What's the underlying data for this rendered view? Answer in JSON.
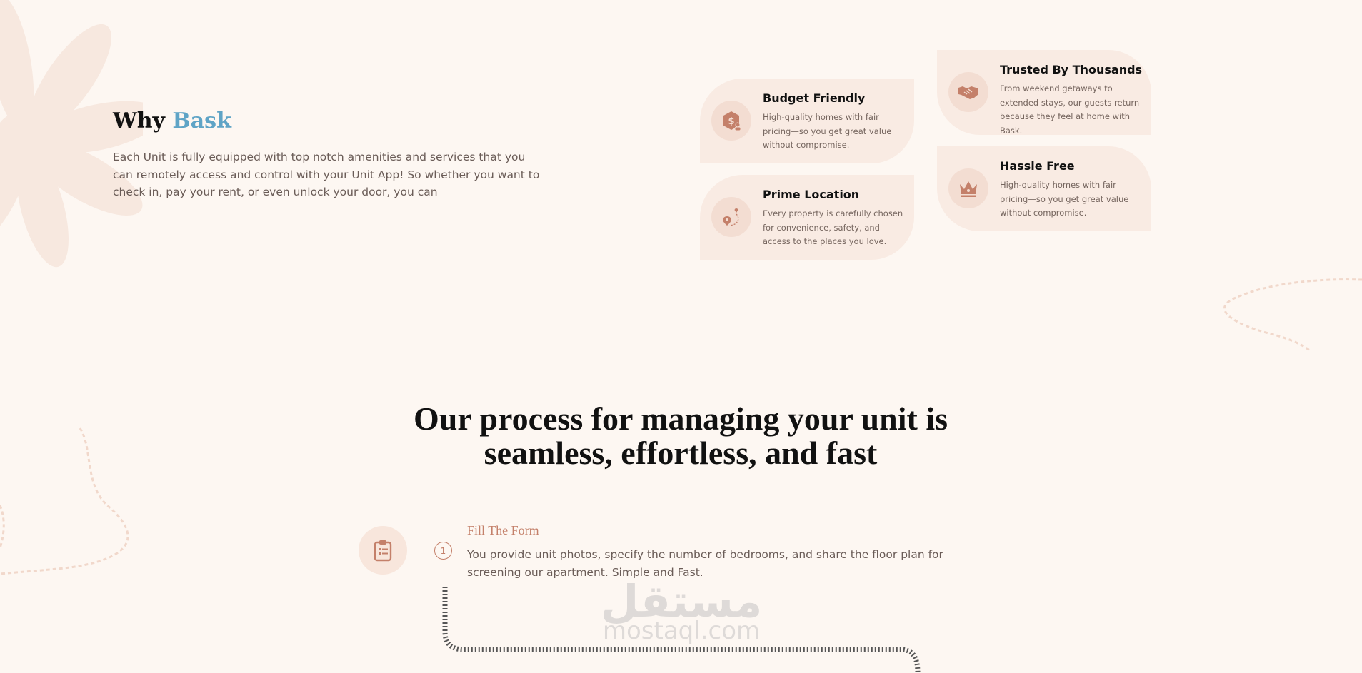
{
  "why": {
    "title_prefix": "Why",
    "title_accent": "Bask",
    "description": "Each Unit is fully equipped with top notch amenities and services that you can remotely access and control with your Unit App! So whether you want to check in, pay your rent, or even unlock your door, you can"
  },
  "features": [
    {
      "title": "Budget Friendly",
      "description": "High-quality homes with fair pricing—so you get great value without compromise.",
      "icon": "price-tag-icon"
    },
    {
      "title": "Prime Location",
      "description": "Every property is carefully chosen for convenience, safety, and access to the places you love.",
      "icon": "location-pin-icon"
    },
    {
      "title": "Trusted By Thousands",
      "description": "From weekend getaways to extended stays, our guests return because they feel at home with Bask.",
      "icon": "handshake-icon"
    },
    {
      "title": "Hassle Free",
      "description": "High-quality homes with fair pricing—so you get great value without compromise.",
      "icon": "crown-icon"
    }
  ],
  "process": {
    "title_line1": "Our process for managing your unit is",
    "title_line2": "seamless, effortless, and fast",
    "steps": [
      {
        "number": "1",
        "title": "Fill The Form",
        "description": "You provide unit photos, specify the number of bedrooms, and share the floor plan for screening our apartment. Simple and Fast.",
        "icon": "clipboard-icon"
      }
    ]
  },
  "watermark": {
    "arabic": "مستقل",
    "latin": "mostaql.com"
  },
  "colors": {
    "background": "#fdf7f2",
    "accent_blue": "#5fa4c6",
    "accent_terracotta": "#c4806a",
    "card_background": "#f9ebe3"
  }
}
